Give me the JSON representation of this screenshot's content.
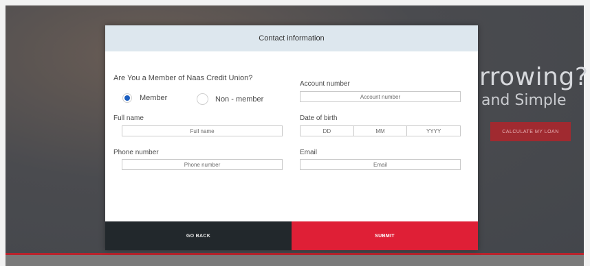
{
  "background": {
    "hero_title": "rrowing?",
    "hero_subtitle": "and Simple",
    "hero_button": "CALCULATE MY LOAN"
  },
  "modal": {
    "title": "Contact information",
    "membership": {
      "question": "Are You a Member of Naas Credit Union?",
      "options": [
        {
          "label": "Member",
          "selected": true
        },
        {
          "label": "Non - member",
          "selected": false
        }
      ]
    },
    "fields": {
      "full_name": {
        "label": "Full name",
        "placeholder": "Full name"
      },
      "phone": {
        "label": "Phone number",
        "placeholder": "Phone number"
      },
      "account": {
        "label": "Account number",
        "placeholder": "Account number"
      },
      "dob": {
        "label": "Date of birth",
        "day": "DD",
        "month": "MM",
        "year": "YYYY"
      },
      "email": {
        "label": "Email",
        "placeholder": "Email"
      }
    },
    "buttons": {
      "back": "GO BACK",
      "submit": "SUBMIT"
    }
  },
  "colors": {
    "submit": "#df1f36",
    "back": "#22282c",
    "header": "#dde7ee",
    "radio_selected": "#1c5fc0"
  }
}
